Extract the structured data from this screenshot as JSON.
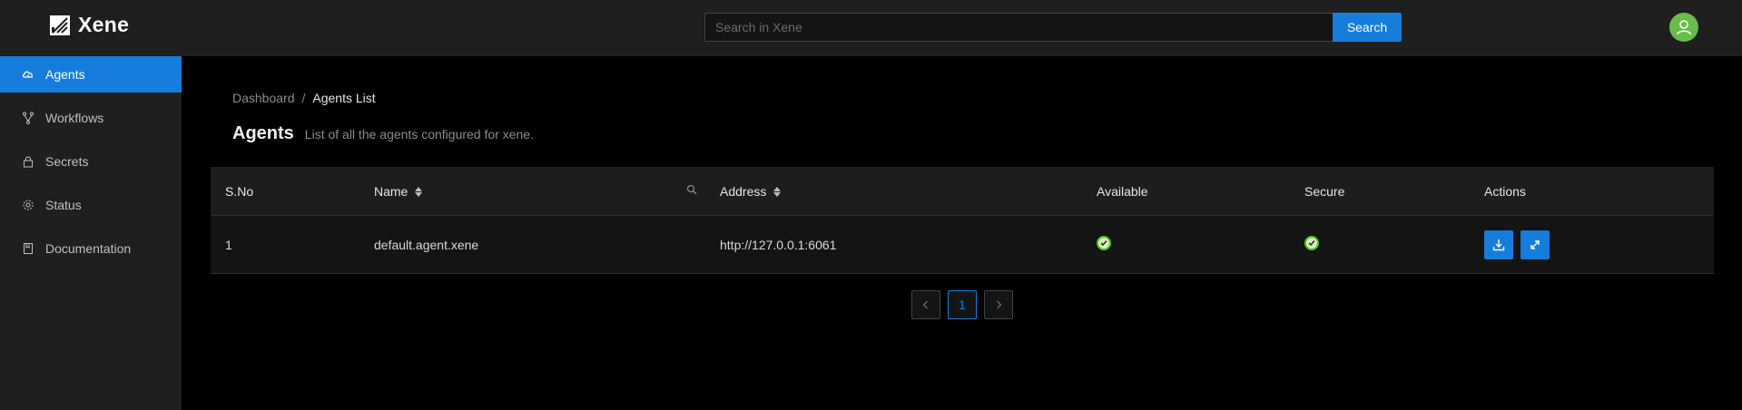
{
  "app": {
    "name": "Xene"
  },
  "search": {
    "placeholder": "Search in Xene",
    "button_label": "Search"
  },
  "sidebar": {
    "items": [
      {
        "label": "Agents",
        "icon": "cloud-icon",
        "active": true
      },
      {
        "label": "Workflows",
        "icon": "fork-icon",
        "active": false
      },
      {
        "label": "Secrets",
        "icon": "lock-icon",
        "active": false
      },
      {
        "label": "Status",
        "icon": "gear-icon",
        "active": false
      },
      {
        "label": "Documentation",
        "icon": "book-icon",
        "active": false
      }
    ]
  },
  "breadcrumb": {
    "parent": "Dashboard",
    "separator": "/",
    "current": "Agents List"
  },
  "page": {
    "title": "Agents",
    "subtitle": "List of all the agents configured for xene."
  },
  "table": {
    "columns": [
      "S.No",
      "Name",
      "Address",
      "Available",
      "Secure",
      "Actions"
    ],
    "rows": [
      {
        "sno": "1",
        "name": "default.agent.xene",
        "address": "http://127.0.0.1:6061",
        "available": true,
        "secure": true
      }
    ]
  },
  "pagination": {
    "current_page": "1"
  },
  "colors": {
    "accent": "#177ddc",
    "avatar": "#68bd4a",
    "success": "#52c41a",
    "header_bg": "#1f1f1f",
    "page_bg": "#000000"
  }
}
